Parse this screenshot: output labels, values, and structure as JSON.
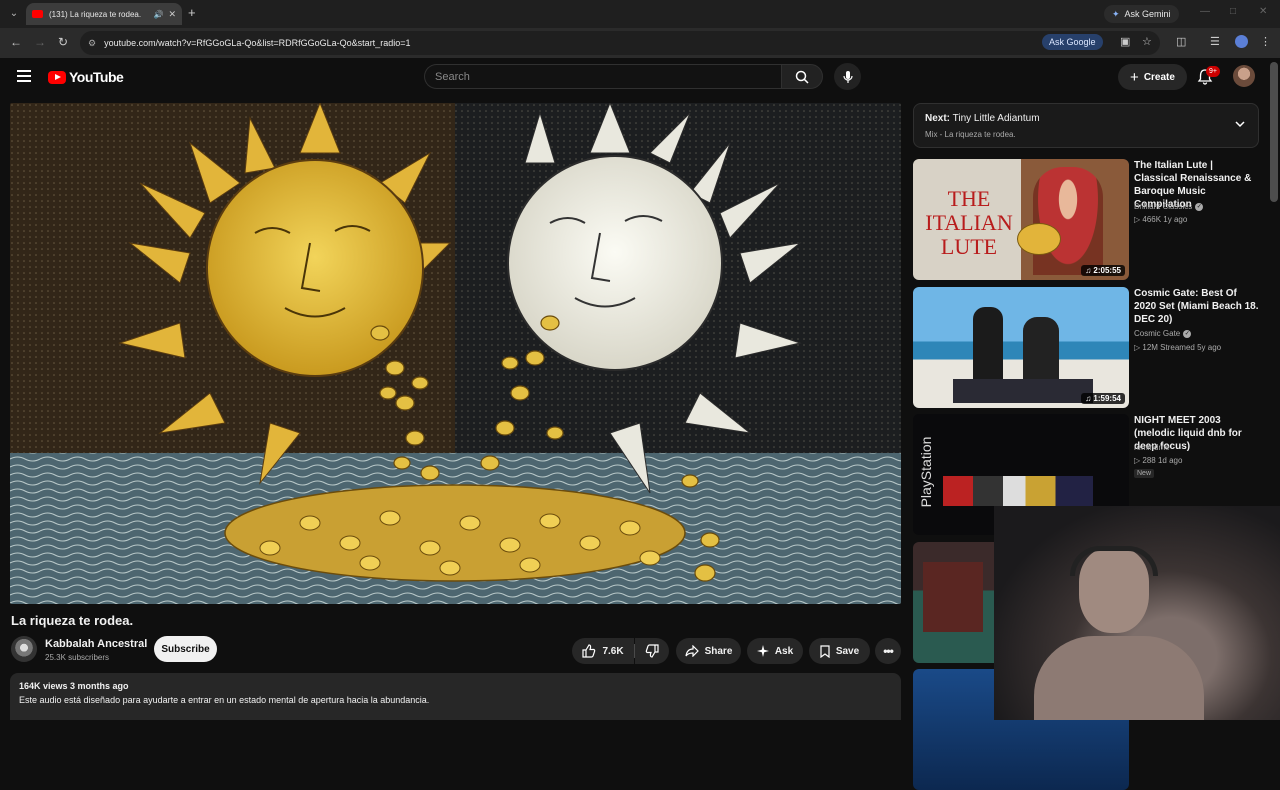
{
  "browser": {
    "tab_title": "(131) La riqueza te rodea.",
    "gemini_label": "Ask Gemini",
    "url": "youtube.com/watch?v=RfGGoGLa-Qo&list=RDRfGGoGLa-Qo&start_radio=1",
    "ask_google_label": "Ask Google"
  },
  "header": {
    "logo_text": "YouTube",
    "search_placeholder": "Search",
    "create_label": "Create",
    "notification_count": "9+"
  },
  "video": {
    "title": "La riqueza te rodea.",
    "channel_name": "Kabbalah Ancestral",
    "subscribers": "25.3K subscribers",
    "subscribe_label": "Subscribe",
    "likes": "7.6K",
    "share_label": "Share",
    "ask_label": "Ask",
    "save_label": "Save",
    "views_date": "164K views  3 months ago",
    "description": "Este audio está diseñado para ayudarte a entrar en un estado mental de apertura hacia la abundancia."
  },
  "sidebar": {
    "next_label": "Next:",
    "next_title": "Tiny Little Adiantum",
    "next_sub": "Mix - La riqueza te rodea.",
    "recs": [
      {
        "title": "The Italian Lute | Classical Renaissance & Baroque Music Compilation",
        "thumb_text": "THE ITALIAN LUTE",
        "channel": "Brilliant Classics",
        "meta": "466K  1y ago",
        "duration": "2:05:55"
      },
      {
        "title": "Cosmic Gate: Best Of 2020 Set (Miami Beach 18. DEC 20)",
        "channel": "Cosmic Gate",
        "meta": "12M  Streamed 5y ago",
        "duration": "1:59:54"
      },
      {
        "title": "NIGHT MEET 2003 (melodic liquid dnb for deep focus)",
        "thumb_text": "PlayStation",
        "channel": "remindme",
        "meta": "288  1d ago",
        "badge": "New"
      }
    ]
  },
  "colors": {
    "background": "#0f0f0f",
    "brand_red": "#ff0000",
    "pill_bg": "#272727"
  }
}
